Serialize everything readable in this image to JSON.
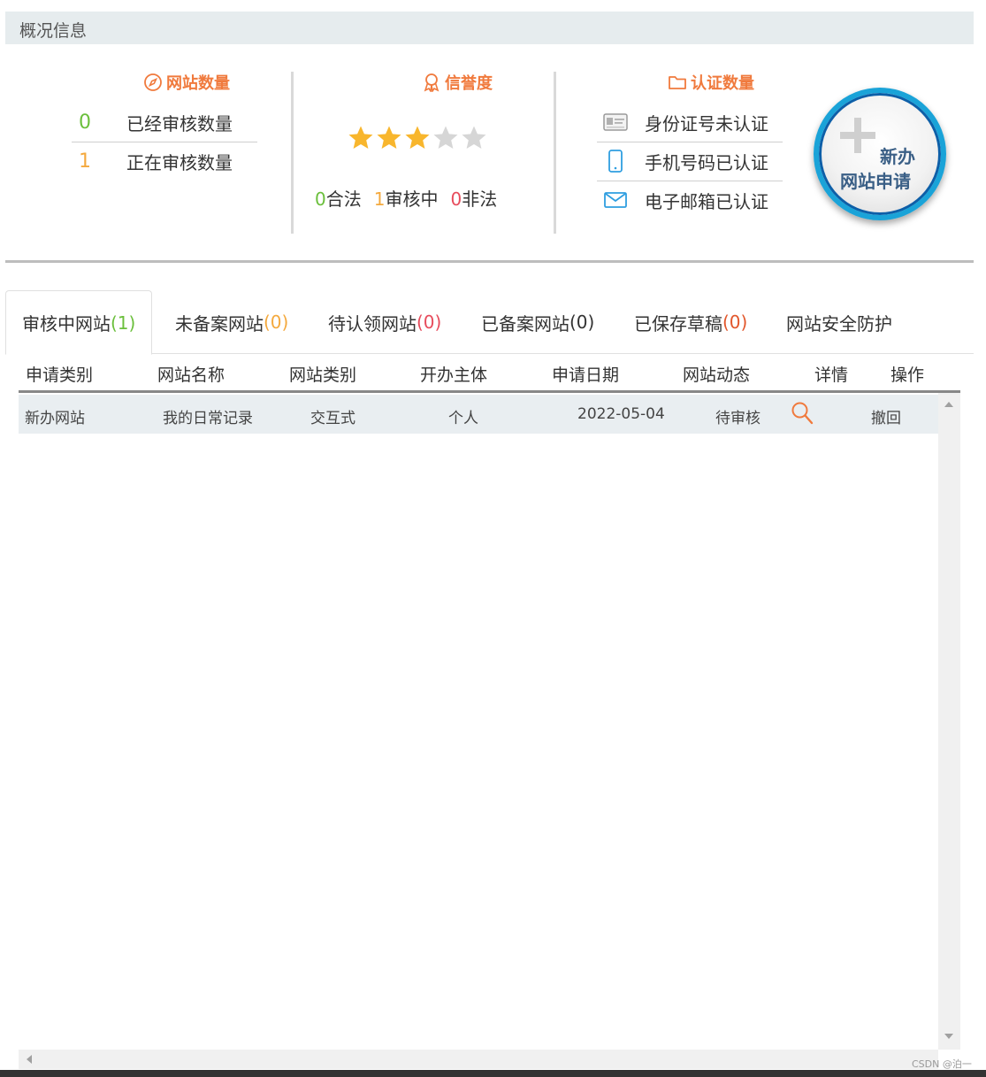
{
  "header": {
    "title": "概况信息"
  },
  "summary": {
    "site_count": {
      "title": "网站数量",
      "rows": [
        {
          "num": "0",
          "label": "已经审核数量"
        },
        {
          "num": "1",
          "label": "正在审核数量"
        }
      ]
    },
    "credit": {
      "title": "信誉度",
      "stars_filled": 3,
      "stars_total": 5,
      "legal": {
        "num": "0",
        "label": "合法"
      },
      "reviewing": {
        "num": "1",
        "label": "审核中"
      },
      "illegal": {
        "num": "0",
        "label": "非法"
      }
    },
    "auth_count": {
      "title": "认证数量",
      "rows": [
        {
          "icon": "id-card-icon",
          "label": "身份证号未认证"
        },
        {
          "icon": "mobile-phone-icon",
          "label": "手机号码已认证"
        },
        {
          "icon": "email-icon",
          "label": "电子邮箱已认证"
        }
      ]
    },
    "new_button": {
      "line1": "新办",
      "line2": "网站申请"
    }
  },
  "tabs": [
    {
      "label": "审核中网站",
      "count": "(1)"
    },
    {
      "label": "未备案网站",
      "count": "(0)"
    },
    {
      "label": "待认领网站",
      "count": "(0)"
    },
    {
      "label": "已备案网站",
      "count": "(0)"
    },
    {
      "label": "已保存草稿",
      "count": "(0)"
    },
    {
      "label": "网站安全防护",
      "count": ""
    }
  ],
  "table": {
    "columns": [
      "申请类别",
      "网站名称",
      "网站类别",
      "开办主体",
      "申请日期",
      "网站动态",
      "详情",
      "操作"
    ],
    "rows": [
      {
        "type": "新办网站",
        "name": "我的日常记录",
        "category": "交互式",
        "owner": "个人",
        "date": "2022-05-04",
        "status": "待审核",
        "detail_icon": "search-icon",
        "action": "撤回"
      }
    ]
  },
  "watermark": "CSDN @泊一",
  "colors": {
    "accent": "#f07a3d",
    "green": "#6bbf3c",
    "orange": "#f4a93e",
    "red": "#e74c5c",
    "star": "#f8b62d"
  }
}
